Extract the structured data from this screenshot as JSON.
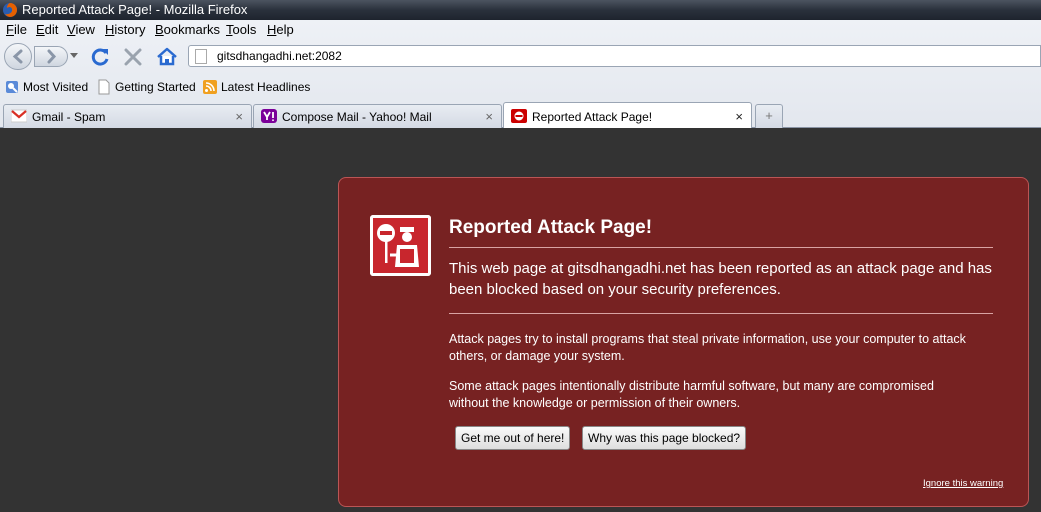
{
  "window": {
    "title": "Reported Attack Page! - Mozilla Firefox"
  },
  "menubar": {
    "items": [
      {
        "label": "File"
      },
      {
        "label": "Edit"
      },
      {
        "label": "View"
      },
      {
        "label": "History"
      },
      {
        "label": "Bookmarks"
      },
      {
        "label": "Tools"
      },
      {
        "label": "Help"
      }
    ]
  },
  "navbar": {
    "url": "gitsdhangadhi.net:2082"
  },
  "bookmarks": {
    "items": [
      {
        "label": "Most Visited",
        "icon": "most-visited-icon"
      },
      {
        "label": "Getting Started",
        "icon": "page-icon"
      },
      {
        "label": "Latest Headlines",
        "icon": "rss-icon"
      }
    ]
  },
  "tabs": [
    {
      "label": "Gmail - Spam",
      "icon": "gmail-icon",
      "active": false
    },
    {
      "label": "Compose Mail - Yahoo! Mail",
      "icon": "yahoo-icon",
      "active": false
    },
    {
      "label": "Reported Attack Page!",
      "icon": "attack-icon",
      "active": true
    }
  ],
  "tab_close_glyph": "×",
  "new_tab_glyph": "+",
  "error_page": {
    "title": "Reported Attack Page!",
    "short_desc": "This web page at gitsdhangadhi.net has been reported as an attack page and has been blocked based on your security preferences.",
    "long_desc_1": "Attack pages try to install programs that steal private information, use your computer to attack others, or damage your system.",
    "long_desc_2": "Some attack pages intentionally distribute harmful software, but many are compromised without the knowledge or permission of their owners.",
    "get_me_out_button": "Get me out of here!",
    "why_blocked_button": "Why was this page blocked?",
    "ignore_warning_link": "Ignore this warning"
  },
  "colors": {
    "panel_background": "#722222",
    "page_background": "#333333"
  }
}
